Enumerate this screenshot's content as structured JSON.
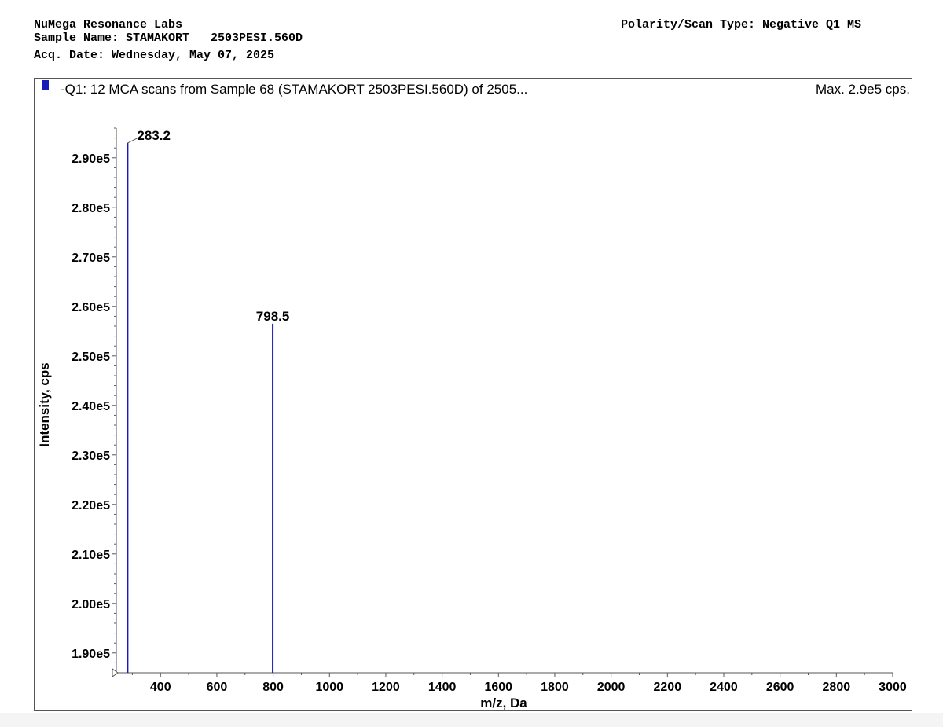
{
  "header": {
    "lab": "NuMega Resonance Labs",
    "sample_label": "Sample Name: STAMAKORT   2503PESI.560D",
    "acq_date": "Acq. Date: Wednesday, May 07, 2025",
    "polarity": "Polarity/Scan Type: Negative Q1 MS"
  },
  "colors": {
    "peak": "#1a1ab8",
    "legend_marker": "#1a1ab8"
  },
  "chart_data": {
    "type": "bar",
    "title": "-Q1: 12 MCA scans from Sample 68 (STAMAKORT   2503PESI.560D) of 2505...",
    "max_label": "Max. 2.9e5 cps.",
    "xlabel": "m/z, Da",
    "ylabel": "Intensity, cps",
    "xlim": [
      243,
      3000
    ],
    "ylim": [
      186000,
      296000
    ],
    "x_ticks": [
      "400",
      "600",
      "800",
      "1000",
      "1200",
      "1400",
      "1600",
      "1800",
      "2000",
      "2200",
      "2400",
      "2600",
      "2800",
      "3000"
    ],
    "y_ticks": [
      "1.90e5",
      "2.00e5",
      "2.10e5",
      "2.20e5",
      "2.30e5",
      "2.40e5",
      "2.50e5",
      "2.60e5",
      "2.70e5",
      "2.80e5",
      "2.90e5"
    ],
    "peaks": [
      {
        "x": 283.2,
        "y": 293000,
        "label": "283.2"
      },
      {
        "x": 798.5,
        "y": 256500,
        "label": "798.5"
      }
    ]
  }
}
